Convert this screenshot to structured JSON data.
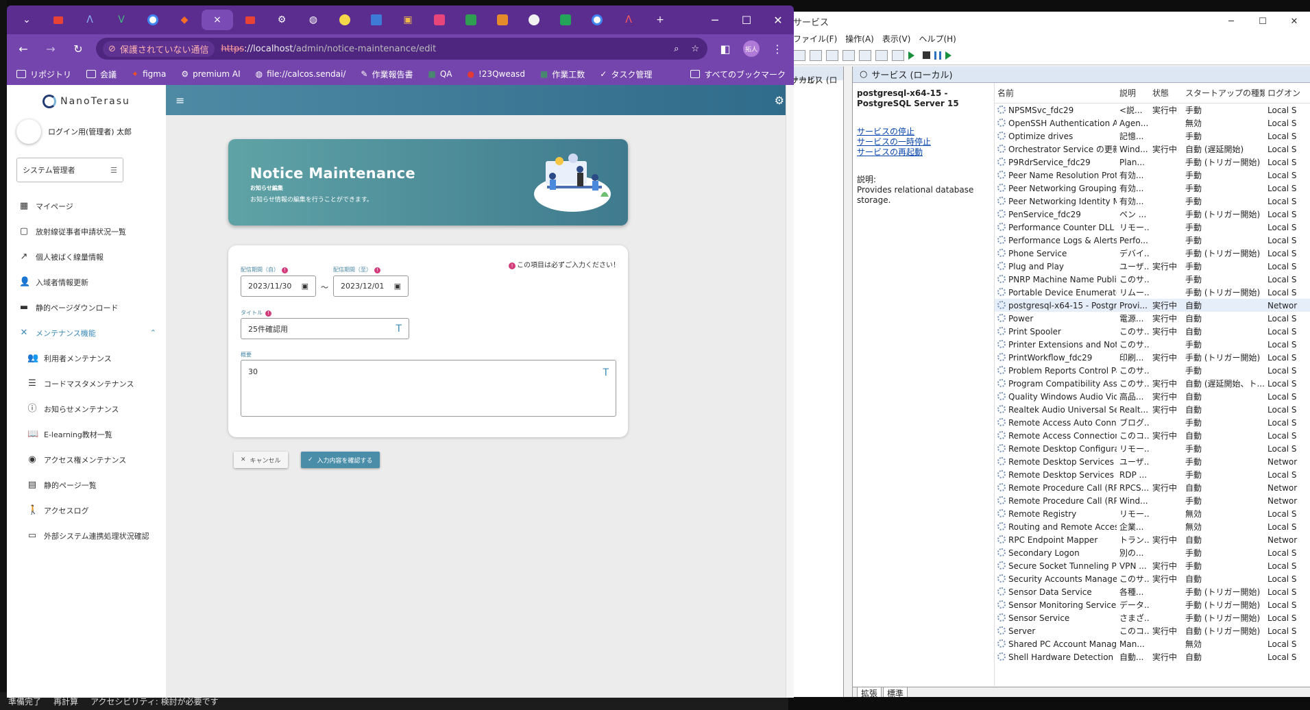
{
  "services_window": {
    "title": "サービス",
    "menu": [
      "ファイル(F)",
      "操作(A)",
      "表示(V)",
      "ヘルプ(H)"
    ],
    "left_tree_label": "サービス (ローカル)",
    "header_title": "サービス (ローカル)",
    "selected_service_name": "postgresql-x64-15 - PostgreSQL Server 15",
    "actions": [
      "サービスの停止",
      "サービスの一時停止",
      "サービスの再起動"
    ],
    "description_label": "説明:",
    "description": "Provides relational database storage.",
    "columns": [
      "名前",
      "説明",
      "状態",
      "スタートアップの種類",
      "ログオン"
    ],
    "rows": [
      {
        "name": "NPSMSvc_fdc29",
        "desc": "<説...",
        "status": "実行中",
        "startup": "手動",
        "logon": "Local S"
      },
      {
        "name": "OpenSSH Authentication A...",
        "desc": "Agen...",
        "status": "",
        "startup": "無効",
        "logon": "Local S"
      },
      {
        "name": "Optimize drives",
        "desc": "記憶...",
        "status": "",
        "startup": "手動",
        "logon": "Local S"
      },
      {
        "name": "Orchestrator Service の更新",
        "desc": "Wind...",
        "status": "実行中",
        "startup": "自動 (遅延開始)",
        "logon": "Local S"
      },
      {
        "name": "P9RdrService_fdc29",
        "desc": "Plan...",
        "status": "",
        "startup": "手動 (トリガー開始)",
        "logon": "Local S"
      },
      {
        "name": "Peer Name Resolution Prot...",
        "desc": "有効...",
        "status": "",
        "startup": "手動",
        "logon": "Local S"
      },
      {
        "name": "Peer Networking Grouping",
        "desc": "有効...",
        "status": "",
        "startup": "手動",
        "logon": "Local S"
      },
      {
        "name": "Peer Networking Identity M...",
        "desc": "有効...",
        "status": "",
        "startup": "手動",
        "logon": "Local S"
      },
      {
        "name": "PenService_fdc29",
        "desc": "ペン ...",
        "status": "",
        "startup": "手動 (トリガー開始)",
        "logon": "Local S"
      },
      {
        "name": "Performance Counter DLL H...",
        "desc": "リモー...",
        "status": "",
        "startup": "手動",
        "logon": "Local S"
      },
      {
        "name": "Performance Logs & Alerts",
        "desc": "Perfo...",
        "status": "",
        "startup": "手動",
        "logon": "Local S"
      },
      {
        "name": "Phone Service",
        "desc": "デバイ...",
        "status": "",
        "startup": "手動 (トリガー開始)",
        "logon": "Local S"
      },
      {
        "name": "Plug and Play",
        "desc": "ユーザ...",
        "status": "実行中",
        "startup": "手動",
        "logon": "Local S"
      },
      {
        "name": "PNRP Machine Name Publi...",
        "desc": "このサ...",
        "status": "",
        "startup": "手動",
        "logon": "Local S"
      },
      {
        "name": "Portable Device Enumerator...",
        "desc": "リムー...",
        "status": "",
        "startup": "手動 (トリガー開始)",
        "logon": "Local S"
      },
      {
        "name": "postgresql-x64-15 - Postgre...",
        "desc": "Provi...",
        "status": "実行中",
        "startup": "自動",
        "logon": "Networ"
      },
      {
        "name": "Power",
        "desc": "電源...",
        "status": "実行中",
        "startup": "自動",
        "logon": "Local S"
      },
      {
        "name": "Print Spooler",
        "desc": "このサ...",
        "status": "実行中",
        "startup": "自動",
        "logon": "Local S"
      },
      {
        "name": "Printer Extensions and Notif...",
        "desc": "このサ...",
        "status": "",
        "startup": "手動",
        "logon": "Local S"
      },
      {
        "name": "PrintWorkflow_fdc29",
        "desc": "印刷...",
        "status": "実行中",
        "startup": "手動 (トリガー開始)",
        "logon": "Local S"
      },
      {
        "name": "Problem Reports Control Pa...",
        "desc": "このサ...",
        "status": "",
        "startup": "手動",
        "logon": "Local S"
      },
      {
        "name": "Program Compatibility Assis...",
        "desc": "このサ...",
        "status": "実行中",
        "startup": "自動 (遅延開始、ト...",
        "logon": "Local S"
      },
      {
        "name": "Quality Windows Audio Vid...",
        "desc": "高品...",
        "status": "実行中",
        "startup": "自動",
        "logon": "Local S"
      },
      {
        "name": "Realtek Audio Universal Ser...",
        "desc": "Realt...",
        "status": "実行中",
        "startup": "自動",
        "logon": "Local S"
      },
      {
        "name": "Remote Access Auto Conne...",
        "desc": "ブログ...",
        "status": "",
        "startup": "手動",
        "logon": "Local S"
      },
      {
        "name": "Remote Access Connection ...",
        "desc": "このコ...",
        "status": "実行中",
        "startup": "自動",
        "logon": "Local S"
      },
      {
        "name": "Remote Desktop Configurati...",
        "desc": "リモー...",
        "status": "",
        "startup": "手動",
        "logon": "Local S"
      },
      {
        "name": "Remote Desktop Services",
        "desc": "ユーザ...",
        "status": "",
        "startup": "手動",
        "logon": "Networ"
      },
      {
        "name": "Remote Desktop Services Us...",
        "desc": "RDP ...",
        "status": "",
        "startup": "手動",
        "logon": "Local S"
      },
      {
        "name": "Remote Procedure Call (RPC)",
        "desc": "RPCS...",
        "status": "実行中",
        "startup": "自動",
        "logon": "Networ"
      },
      {
        "name": "Remote Procedure Call (RPC...",
        "desc": "Wind...",
        "status": "",
        "startup": "手動",
        "logon": "Networ"
      },
      {
        "name": "Remote Registry",
        "desc": "リモー...",
        "status": "",
        "startup": "無効",
        "logon": "Local S"
      },
      {
        "name": "Routing and Remote Access",
        "desc": "企業...",
        "status": "",
        "startup": "無効",
        "logon": "Local S"
      },
      {
        "name": "RPC Endpoint Mapper",
        "desc": "トラン...",
        "status": "実行中",
        "startup": "自動",
        "logon": "Networ"
      },
      {
        "name": "Secondary Logon",
        "desc": "別の...",
        "status": "",
        "startup": "手動",
        "logon": "Local S"
      },
      {
        "name": "Secure Socket Tunneling Pr...",
        "desc": "VPN ...",
        "status": "実行中",
        "startup": "手動",
        "logon": "Local S"
      },
      {
        "name": "Security Accounts Manager",
        "desc": "このサ...",
        "status": "実行中",
        "startup": "自動",
        "logon": "Local S"
      },
      {
        "name": "Sensor Data Service",
        "desc": "各種...",
        "status": "",
        "startup": "手動 (トリガー開始)",
        "logon": "Local S"
      },
      {
        "name": "Sensor Monitoring Service",
        "desc": "データ...",
        "status": "",
        "startup": "手動 (トリガー開始)",
        "logon": "Local S"
      },
      {
        "name": "Sensor Service",
        "desc": "さまざ...",
        "status": "",
        "startup": "手動 (トリガー開始)",
        "logon": "Local S"
      },
      {
        "name": "Server",
        "desc": "このコ...",
        "status": "実行中",
        "startup": "自動 (トリガー開始)",
        "logon": "Local S"
      },
      {
        "name": "Shared PC Account Manager",
        "desc": "Man...",
        "status": "",
        "startup": "無効",
        "logon": "Local S"
      },
      {
        "name": "Shell Hardware Detection",
        "desc": "自動...",
        "status": "実行中",
        "startup": "自動",
        "logon": "Local S"
      }
    ],
    "tabs": [
      "拡張",
      "標準"
    ]
  },
  "excel_status": [
    "準備完了",
    "再計算",
    "アクセシビリティ: 検討が必要です"
  ],
  "browser": {
    "tab_close": "×",
    "new_tab": "+",
    "security_warning": "保護されていない通信",
    "url_scheme": "https",
    "url_host": "://localhost",
    "url_path": "/admin/notice-maintenance/edit",
    "profile_label": "拓人",
    "bookmarks": [
      "リポジトリ",
      "会議",
      "figma",
      "premium AI",
      "file://calcos.sendai/",
      "作業報告書",
      "QA",
      "!23Qweasd",
      "作業工数",
      "タスク管理"
    ],
    "all_bookmarks": "すべてのブックマーク"
  },
  "app": {
    "logo": "NanoTerasu",
    "user_name": "ログイン用(管理者) 太郎",
    "role": "システム管理者",
    "nav": [
      {
        "label": "マイページ"
      },
      {
        "label": "放射線従事者申請状況一覧"
      },
      {
        "label": "個人被ばく線量情報"
      },
      {
        "label": "入域者情報更新"
      },
      {
        "label": "静的ページダウンロード"
      }
    ],
    "maintenance_section": "メンテナンス機能",
    "sub_nav": [
      {
        "label": "利用者メンテナンス"
      },
      {
        "label": "コードマスタメンテナンス"
      },
      {
        "label": "お知らせメンテナンス"
      },
      {
        "label": "E-learning教材一覧"
      },
      {
        "label": "アクセス権メンテナンス"
      },
      {
        "label": "静的ページ一覧"
      },
      {
        "label": "アクセスログ"
      },
      {
        "label": "外部システム連携処理状況確認"
      }
    ],
    "banner": {
      "title": "Notice Maintenance",
      "subtitle": "お知らせ編集",
      "description": "お知らせ情報の編集を行うことができます。"
    },
    "form": {
      "required_note": "この項目は必ずご入力ください！",
      "start_label": "配信期間（自）",
      "start_value": "2023/11/30",
      "end_label": "配信期間（至）",
      "end_value": "2023/12/01",
      "range_sep": "～",
      "title_label": "タイトル",
      "title_value": "25件確認用",
      "summary_label": "概要",
      "summary_value": "30"
    },
    "cancel_button": "キャンセル",
    "confirm_button": "入力内容を確認する"
  }
}
